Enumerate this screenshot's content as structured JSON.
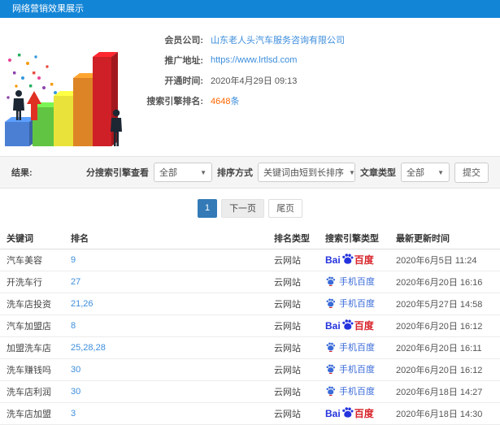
{
  "header": {
    "title": "网络营销效果展示"
  },
  "colors": {
    "header_bg": "#1385d6",
    "link_blue": "#3c8ddc",
    "accent_orange": "#ff6600",
    "pagination_active_bg": "#337ab7",
    "baidu_blue": "#2433dd",
    "baidu_red": "#d8232a",
    "mobile_blue": "#3a6bd8"
  },
  "icons": {
    "chevron_down": "▼"
  },
  "illustration": {
    "name": "3d-bar-chart-with-businessmen",
    "bars": [
      "#4a7fd4",
      "#62c443",
      "#e8e23a",
      "#dd8426",
      "#cf2027"
    ],
    "arrow": "#e03024",
    "figure": "#1c2733"
  },
  "info": {
    "rows": [
      {
        "label": "会员公司:",
        "value": "山东老人头汽车服务咨询有限公司"
      },
      {
        "label": "推广地址:",
        "value": "https://www.lrtlsd.com"
      },
      {
        "label": "开通时间:",
        "value": "2020年4月29日 09:13"
      },
      {
        "label": "搜索引擎排名:",
        "value": "4648",
        "unit": "条"
      }
    ]
  },
  "filter": {
    "result_label": "结果:",
    "engine_label": "分搜索引擎查看",
    "engine_value": "全部",
    "sort_label": "排序方式",
    "sort_value": "关键词由短到长排序",
    "article_label": "文章类型",
    "article_value": "全部",
    "submit_label": "提交"
  },
  "pagination": {
    "current": "1",
    "next": "下一页",
    "last": "尾页"
  },
  "engine_assets": {
    "pc_left": "Bai",
    "pc_right": "百度",
    "mobile_text": "手机百度"
  },
  "table": {
    "headers": [
      "关键词",
      "排名",
      "排名类型",
      "搜索引擎类型",
      "最新更新时间"
    ],
    "rows": [
      {
        "keyword": "汽车美容",
        "rank": "9",
        "rank_type": "云网站",
        "engine": "baidu-pc",
        "time": "2020年6月5日 11:24"
      },
      {
        "keyword": "开洗车行",
        "rank": "27",
        "rank_type": "云网站",
        "engine": "baidu-mobile",
        "time": "2020年6月20日 16:16"
      },
      {
        "keyword": "洗车店投资",
        "rank": "21,26",
        "rank_type": "云网站",
        "engine": "baidu-mobile",
        "time": "2020年5月27日 14:58"
      },
      {
        "keyword": "汽车加盟店",
        "rank": "8",
        "rank_type": "云网站",
        "engine": "baidu-pc",
        "time": "2020年6月20日 16:12"
      },
      {
        "keyword": "加盟洗车店",
        "rank": "25,28,28",
        "rank_type": "云网站",
        "engine": "baidu-mobile",
        "time": "2020年6月20日 16:11"
      },
      {
        "keyword": "洗车赚钱吗",
        "rank": "30",
        "rank_type": "云网站",
        "engine": "baidu-mobile",
        "time": "2020年6月20日 16:12"
      },
      {
        "keyword": "洗车店利润",
        "rank": "30",
        "rank_type": "云网站",
        "engine": "baidu-mobile",
        "time": "2020年6月18日 14:27"
      },
      {
        "keyword": "洗车店加盟",
        "rank": "3",
        "rank_type": "云网站",
        "engine": "baidu-pc",
        "time": "2020年6月18日 14:30"
      }
    ]
  }
}
